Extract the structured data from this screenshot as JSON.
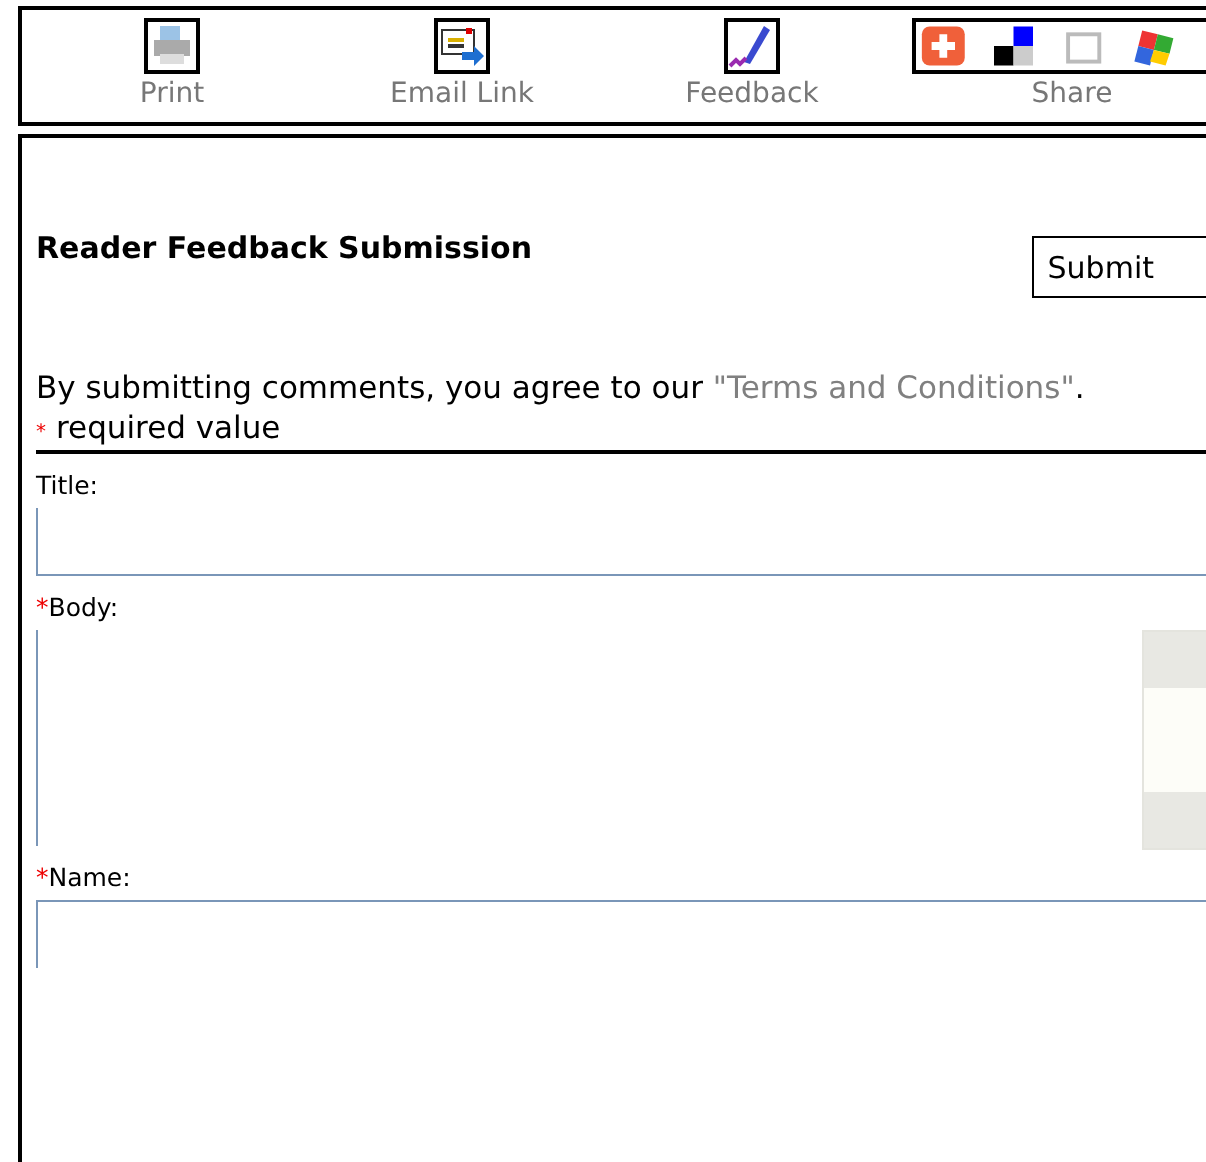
{
  "toolbar": [
    {
      "kind": "print",
      "label": "Print"
    },
    {
      "kind": "email",
      "label": "Email Link"
    },
    {
      "kind": "feedback",
      "label": "Feedback"
    },
    {
      "kind": "share",
      "label": "Share"
    }
  ],
  "form": {
    "title": "Reader Feedback Submission",
    "submit": "Submit",
    "agreement": "By submitting comments, you agree to our ",
    "terms_link": "\"Terms and Conditions\"",
    "agreement_end": ".",
    "required_mark": "*",
    "required_note": "required value",
    "fields": [
      {
        "kind": "line",
        "label": "Title:",
        "required": false
      },
      {
        "kind": "area",
        "label": "Body:",
        "required": true
      },
      {
        "kind": "line",
        "label": "Name:",
        "required": true
      }
    ]
  }
}
